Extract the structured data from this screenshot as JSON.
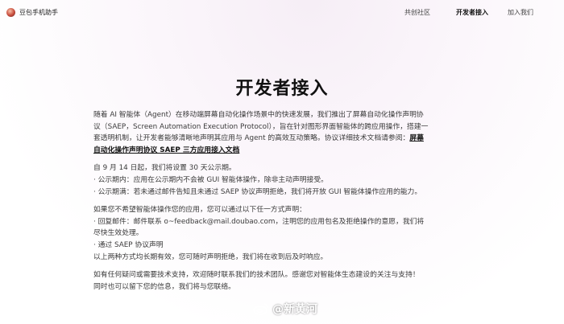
{
  "header": {
    "brand": "豆包手机助手",
    "nav": [
      "共创社区",
      "开发者接入",
      "加入我们"
    ]
  },
  "page": {
    "title": "开发者接入",
    "intro_text": "随着 AI 智能体（Agent）在移动端屏幕自动化操作场景中的快速发展，我们推出了屏幕自动化操作声明协议（SAEP，Screen Automation Execution Protocol），旨在针对图形界面智能体的跨应用操作，搭建一套透明机制，让开发者能够清晰地声明其应用与 Agent 的高效互动策略。协议详细技术文档请参阅：",
    "intro_link": "屏幕自动化操作声明协议 SAEP 三方应用接入文档",
    "notice_lines": [
      "自 9 月 14 日起，我们将设置 30 天公示期。",
      "· 公示期内：应用在公示期内不会被 GUI 智能体操作，除非主动声明接受。",
      "· 公示期满：若未通过邮件告知且未通过 SAEP 协议声明拒绝，我们将开放 GUI 智能体操作应用的能力。"
    ],
    "decline_lines": [
      "如果您不希望智能体操作您的应用，您可以通过以下任一方式声明：",
      "·  回复邮件：邮件联系 o~feedback@mail.doubao.com，注明您的应用包名及拒绝操作的意愿，我们将尽快生效处理。",
      "·  通过 SAEP 协议声明",
      "以上两种方式均长期有效，您可随时声明拒绝，我们将在收到后及时响应。"
    ],
    "closing_lines": [
      "如有任何疑问或需要技术支持，欢迎随时联系我们的技术团队。感谢您对智能体生态建设的关注与支持！",
      "同时也可以留下您的信息，我们将与您联络。"
    ]
  },
  "watermark": "@新黄河"
}
